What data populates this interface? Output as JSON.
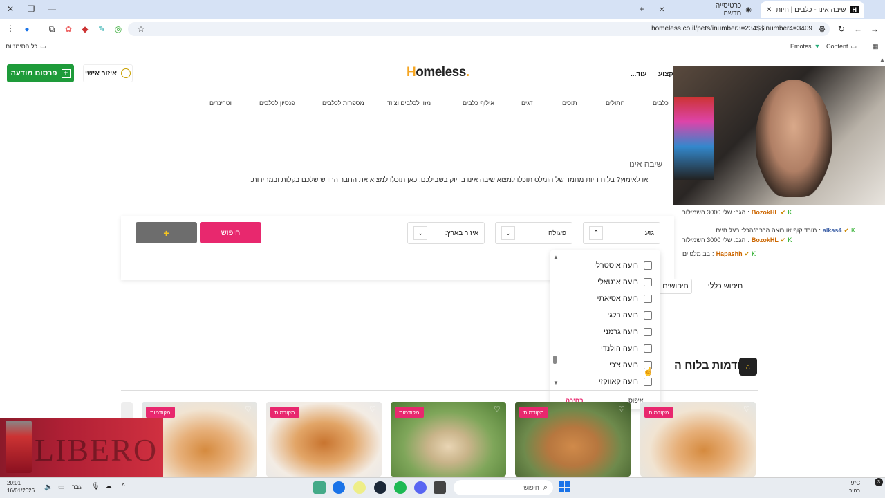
{
  "browser": {
    "tabs": [
      {
        "label": "שיבה אינו - כלבים | חיות מחמד",
        "active": true
      },
      {
        "label": "כרטיסייה חדשה",
        "active": false
      }
    ],
    "url": "homeless.co.il/pets/inumber3=234$$inumber4=3409",
    "bookmarks_left": "כל הסימניות",
    "bookmarks_right": [
      "Emotes",
      "Content"
    ]
  },
  "header": {
    "publish_button": "פרסום מודעה",
    "personal_area": "איזור אישי",
    "logo_h": "H",
    "logo_rest": "omeless",
    "more": "עוד...",
    "kitsutz": "קקצוע"
  },
  "categories": [
    "כלבים",
    "חתולים",
    "תוכים",
    "דגים",
    "אילוף כלבים",
    "מזון לכלבים וציוד",
    "מספרות לכלבים",
    "פנסיון לכלבים",
    "וטרינרים"
  ],
  "breadcrumb": "שיבה אינו",
  "description": "או לאימוץ? בלוח חיות מחמד של הומלס תוכלו למצוא שיבה אינו בדיוק בשבילכם. כאן תוכלו למצוא את החבר החדש שלכם בקלות ובמהירות.",
  "search": {
    "breed_label": "גזע",
    "action_label": "פעולה",
    "region_label": "איזור בארץ:",
    "search_button": "חיפוש",
    "plus_button": "+",
    "general_search": "חיפוש כללי",
    "search_tab2": "חיפושים",
    "breed_caret": "⌃"
  },
  "dropdown": {
    "options": [
      "רועה אוסטרלי",
      "רועה אנטאלי",
      "רועה אסיאתי",
      "רועה בלגי",
      "רועה גרמני",
      "רועה הולנדי",
      "רועה צ'כי",
      "רועה קאווקזי"
    ],
    "select": "בחירה",
    "reset": "איפוס"
  },
  "featured": {
    "title": "מקודמות בלוח ה",
    "badge": "מקודמות"
  },
  "chat": [
    {
      "user": "BozokHL",
      "msg": "הגב: שלי 3000 השמילור"
    },
    {
      "user": "alkas4",
      "msg": "מורד קוף או רואה הרבה/הכל: בעל חיים"
    },
    {
      "user": "BozokHL",
      "msg": "הגב: שלי 3000 השמילור"
    },
    {
      "user": "Hapashh",
      "msg": "בב מלפוים"
    }
  ],
  "ad": {
    "text": "LIBERO"
  },
  "taskbar": {
    "time": "20:01",
    "date": "16/01/2026",
    "lang": "עבר",
    "search_placeholder": "חיפוש",
    "weather_temp": "9°C",
    "weather_desc": "בהיר",
    "notif_count": "3"
  },
  "colors": {
    "green": "#1e9b3a",
    "pink": "#e8286e",
    "accent": "#f5a623"
  }
}
